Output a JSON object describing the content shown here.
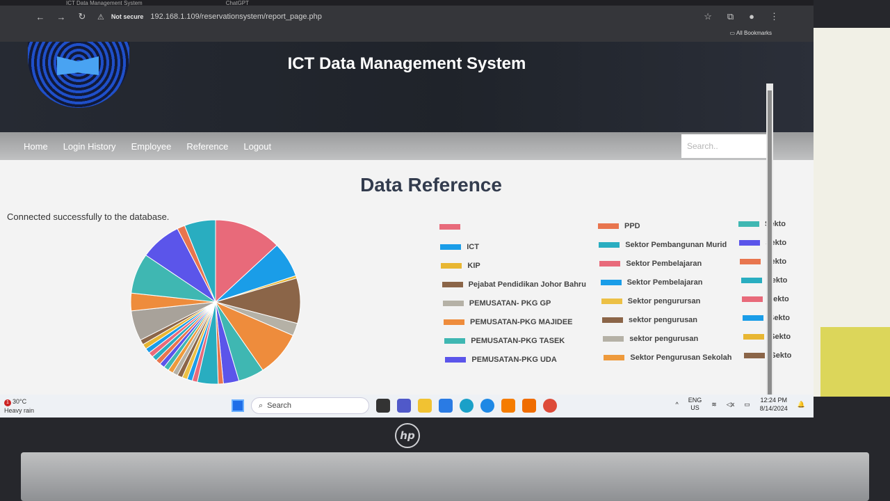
{
  "browser": {
    "tabs": [
      "ICT Data Management System",
      "ChatGPT"
    ],
    "security_label": "Not secure",
    "url": "192.168.1.109/reservationsystem/report_page.php",
    "bookmarks_label": "All Bookmarks"
  },
  "site": {
    "title": "ICT Data Management System",
    "menu": [
      "Home",
      "Login History",
      "Employee",
      "Reference",
      "Logout"
    ],
    "search_placeholder": "Search.."
  },
  "page": {
    "heading": "Data Reference",
    "status": "Connected successfully to the database."
  },
  "chart_data": {
    "type": "pie",
    "title": "",
    "legend_position": "right",
    "slices": [
      {
        "label": "",
        "value": 13,
        "color": "#e86a7a"
      },
      {
        "label": "ICT",
        "value": 7,
        "color": "#1a9de8"
      },
      {
        "label": "KIP",
        "value": 0.5,
        "color": "#e8b632"
      },
      {
        "label": "Pejabat Pendidikan Johor Bahru",
        "value": 9,
        "color": "#8b6548"
      },
      {
        "label": "PEMUSATAN- PKG GP",
        "value": 2.5,
        "color": "#b5b1a6"
      },
      {
        "label": "PEMUSATAN-PKG MAJIDEE",
        "value": 9,
        "color": "#ee8c3c"
      },
      {
        "label": "PEMUSATAN-PKG TASEK",
        "value": 5,
        "color": "#3fb7b2"
      },
      {
        "label": "PEMUSATAN-PKG UDA",
        "value": 3,
        "color": "#5b55ea"
      },
      {
        "label": "PPD",
        "value": 1,
        "color": "#e8754e"
      },
      {
        "label": "Sektor Pembangunan Murid",
        "value": 4,
        "color": "#29adc0"
      },
      {
        "label": "Sektor Pembelajaran",
        "value": 1,
        "color": "#e86a7a"
      },
      {
        "label": "Sektor Pembelajaran",
        "value": 1,
        "color": "#1a9de8"
      },
      {
        "label": "Sektor pengurursan",
        "value": 1,
        "color": "#ecc045"
      },
      {
        "label": "sektor pengurusan",
        "value": 1,
        "color": "#8b6548"
      },
      {
        "label": "sektor pengurusan",
        "value": 1,
        "color": "#b5b1a6"
      },
      {
        "label": "Sektor Pengurusan Sekolah",
        "value": 1,
        "color": "#ee9a3c"
      },
      {
        "label": "Sekto",
        "value": 1,
        "color": "#3fb7b2"
      },
      {
        "label": "Sekto",
        "value": 1,
        "color": "#5b55ea"
      },
      {
        "label": "sekto",
        "value": 1,
        "color": "#e8754e"
      },
      {
        "label": "sekto",
        "value": 1,
        "color": "#29adc0"
      },
      {
        "label": "Sekto",
        "value": 1,
        "color": "#e86a7a"
      },
      {
        "label": "Sekto",
        "value": 1,
        "color": "#1a9de8"
      },
      {
        "label": "Sekto",
        "value": 1,
        "color": "#e8b632"
      },
      {
        "label": "Sekto",
        "value": 1,
        "color": "#8b6548"
      },
      {
        "label": "",
        "value": 6,
        "color": "#a8a29a"
      },
      {
        "label": "",
        "value": 3.5,
        "color": "#ee8c3c"
      },
      {
        "label": "",
        "value": 8,
        "color": "#3fb7b2"
      },
      {
        "label": "",
        "value": 8,
        "color": "#5b55ea"
      },
      {
        "label": "",
        "value": 1.5,
        "color": "#e8754e"
      },
      {
        "label": "",
        "value": 6,
        "color": "#29adc0"
      }
    ]
  },
  "legend_items": [
    {
      "label": "",
      "color": "#e86a7a"
    },
    {
      "label": "ICT",
      "color": "#1a9de8"
    },
    {
      "label": "KIP",
      "color": "#e8b632"
    },
    {
      "label": "Pejabat Pendidikan Johor Bahru",
      "color": "#8b6548"
    },
    {
      "label": "PEMUSATAN- PKG GP",
      "color": "#b5b1a6"
    },
    {
      "label": "PEMUSATAN-PKG MAJIDEE",
      "color": "#ee8c3c"
    },
    {
      "label": "PEMUSATAN-PKG TASEK",
      "color": "#3fb7b2"
    },
    {
      "label": "PEMUSATAN-PKG UDA",
      "color": "#5b55ea"
    },
    {
      "label": "PPD",
      "color": "#e8754e"
    },
    {
      "label": "Sektor Pembangunan Murid",
      "color": "#29adc0"
    },
    {
      "label": "Sektor Pembelajaran",
      "color": "#e86a7a"
    },
    {
      "label": "Sektor Pembelajaran",
      "color": "#1a9de8"
    },
    {
      "label": "Sektor pengurursan",
      "color": "#ecc045"
    },
    {
      "label": "sektor pengurusan",
      "color": "#8b6548"
    },
    {
      "label": "sektor pengurusan",
      "color": "#b5b1a6"
    },
    {
      "label": "Sektor Pengurusan Sekolah",
      "color": "#ee9a3c"
    },
    {
      "label": "Sekto",
      "color": "#3fb7b2"
    },
    {
      "label": "Sekto",
      "color": "#5b55ea"
    },
    {
      "label": "sekto",
      "color": "#e8754e"
    },
    {
      "label": "sekto",
      "color": "#29adc0"
    },
    {
      "label": "Sekto",
      "color": "#e86a7a"
    },
    {
      "label": "Sekto",
      "color": "#1a9de8"
    },
    {
      "label": "Sekto",
      "color": "#e8b632"
    },
    {
      "label": "Sekto",
      "color": "#8b6548"
    }
  ],
  "taskbar": {
    "temperature": "30°C",
    "weather": "Heavy rain",
    "weather_badge": "1",
    "search_label": "Search",
    "lang_top": "ENG",
    "lang_bottom": "US",
    "time": "12:24 PM",
    "date": "8/14/2024"
  },
  "laptop": {
    "brand": "hp"
  }
}
